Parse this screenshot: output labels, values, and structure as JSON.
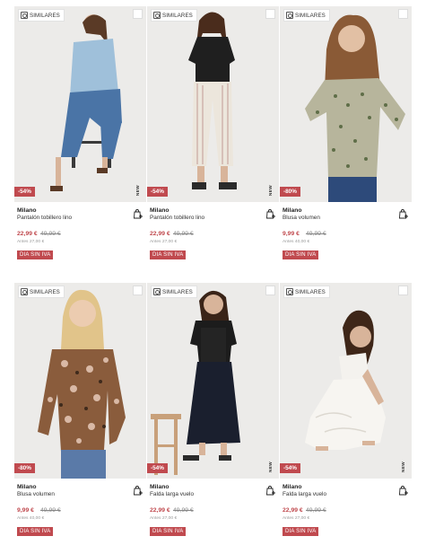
{
  "labels": {
    "similares": "SIMILARES",
    "new_tag": "NEW",
    "dia_sin_iva": "DIA SIN IVA"
  },
  "colors": {
    "accent": "#c04a4f",
    "card_bg": "#ecebe9"
  },
  "icons": {
    "similar": "similar-search-icon",
    "bag": "shopping-bag-add-icon"
  },
  "products": [
    {
      "brand": "Milano",
      "name": "Pantalón tobillero lino",
      "price": "22,99 €",
      "old_price": "49,99 €",
      "before": "Antes 27,00 €",
      "discount": "-54%"
    },
    {
      "brand": "Milano",
      "name": "Pantalón tobillero lino",
      "price": "22,99 €",
      "old_price": "49,99 €",
      "before": "Antes 27,00 €",
      "discount": "-54%"
    },
    {
      "brand": "Milano",
      "name": "Blusa volumen",
      "price": "9,99 €",
      "old_price": "49,99 €",
      "before": "Antes 40,00 €",
      "discount": "-80%"
    },
    {
      "brand": "Milano",
      "name": "Blusa volumen",
      "price": "9,99 €",
      "old_price": "49,99 €",
      "before": "Antes 40,00 €",
      "discount": "-80%"
    },
    {
      "brand": "Milano",
      "name": "Falda larga vuelo",
      "price": "22,99 €",
      "old_price": "49,99 €",
      "before": "Antes 27,00 €",
      "discount": "-54%"
    },
    {
      "brand": "Milano",
      "name": "Falda larga vuelo",
      "price": "22,99 €",
      "old_price": "49,99 €",
      "before": "Antes 27,00 €",
      "discount": "-54%"
    }
  ]
}
